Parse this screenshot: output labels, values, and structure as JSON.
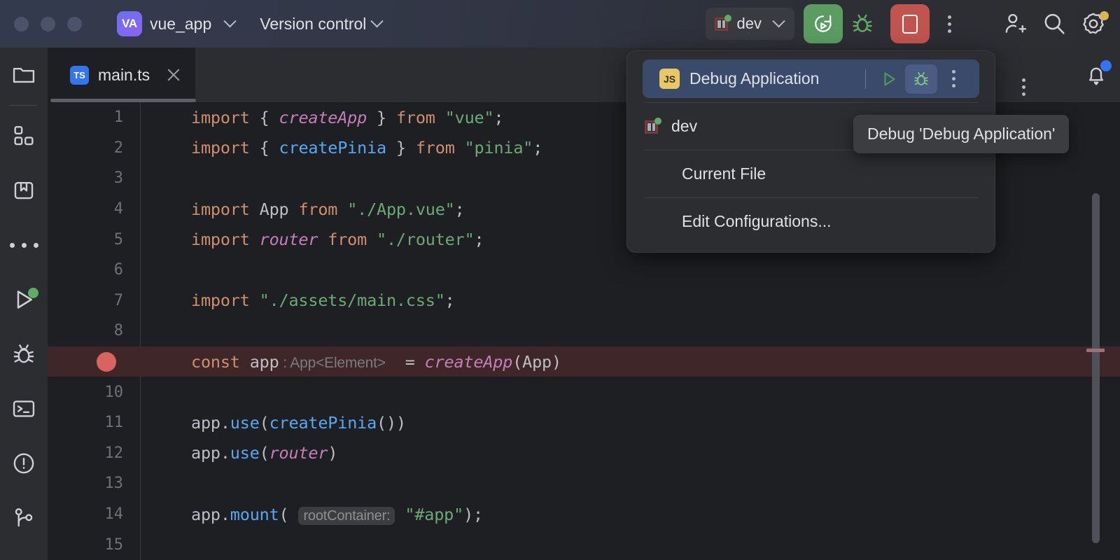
{
  "titlebar": {
    "project_badge": "VA",
    "project_name": "vue_app",
    "vcs_label": "Version control",
    "run_config_label": "dev",
    "traffic_lights": [
      "close",
      "minimize",
      "zoom"
    ]
  },
  "toolbar": {
    "rerun_icon": "rerun-icon",
    "debug_icon": "bug-icon",
    "stop_icon": "stop-icon",
    "more_icon": "more-vertical-icon",
    "add_user_icon": "add-user-icon",
    "search_icon": "search-icon",
    "settings_icon": "gear-icon",
    "settings_badge_color": "#e0b251",
    "green": "#5a9c62",
    "red": "#c25450"
  },
  "sidebar": {
    "items": [
      {
        "name": "project",
        "icon": "folder-icon"
      },
      {
        "name": "commit",
        "icon": "blocks-icon"
      },
      {
        "name": "bookmarks",
        "icon": "bookmark-icon"
      },
      {
        "name": "more-tools",
        "icon": "ellipsis-icon"
      },
      {
        "name": "run",
        "icon": "play-icon",
        "status_dot": "#5fad65"
      },
      {
        "name": "debug",
        "icon": "bug-icon"
      },
      {
        "name": "terminal",
        "icon": "terminal-icon"
      },
      {
        "name": "problems",
        "icon": "warning-circle-icon"
      },
      {
        "name": "version-control",
        "icon": "git-branch-icon"
      }
    ]
  },
  "editor": {
    "tab": {
      "label": "main.ts",
      "badge": "TS",
      "close": "close-icon"
    },
    "notification_icon": "bell-icon",
    "notification_badge_color": "#3574f0",
    "more_icon": "more-vertical-icon",
    "breakpoint_line": 9,
    "lines": [
      {
        "num": "1",
        "tokens": [
          {
            "t": "import ",
            "c": "kw"
          },
          {
            "t": "{ ",
            "c": "pl"
          },
          {
            "t": "createApp",
            "c": "fn"
          },
          {
            "t": " } ",
            "c": "pl"
          },
          {
            "t": "from ",
            "c": "kw"
          },
          {
            "t": "\"vue\"",
            "c": "str"
          },
          {
            "t": ";",
            "c": "pl"
          }
        ]
      },
      {
        "num": "2",
        "tokens": [
          {
            "t": "import ",
            "c": "kw"
          },
          {
            "t": "{ ",
            "c": "pl"
          },
          {
            "t": "createPinia",
            "c": "fn2"
          },
          {
            "t": " } ",
            "c": "pl"
          },
          {
            "t": "from ",
            "c": "kw"
          },
          {
            "t": "\"pinia\"",
            "c": "str"
          },
          {
            "t": ";",
            "c": "pl"
          }
        ]
      },
      {
        "num": "3",
        "tokens": []
      },
      {
        "num": "4",
        "tokens": [
          {
            "t": "import ",
            "c": "kw"
          },
          {
            "t": "App ",
            "c": "pl"
          },
          {
            "t": "from ",
            "c": "kw"
          },
          {
            "t": "\"./App.vue\"",
            "c": "str"
          },
          {
            "t": ";",
            "c": "pl"
          }
        ]
      },
      {
        "num": "5",
        "tokens": [
          {
            "t": "import ",
            "c": "kw"
          },
          {
            "t": "router ",
            "c": "fn"
          },
          {
            "t": "from ",
            "c": "kw"
          },
          {
            "t": "\"./router\"",
            "c": "str"
          },
          {
            "t": ";",
            "c": "pl"
          }
        ]
      },
      {
        "num": "6",
        "tokens": []
      },
      {
        "num": "7",
        "tokens": [
          {
            "t": "import ",
            "c": "kw"
          },
          {
            "t": "\"./assets/main.css\"",
            "c": "str"
          },
          {
            "t": ";",
            "c": "pl"
          }
        ]
      },
      {
        "num": "8",
        "tokens": []
      },
      {
        "num": "9",
        "highlight": true,
        "breakpoint": true,
        "tokens": [
          {
            "t": "const ",
            "c": "kw"
          },
          {
            "t": "app",
            "c": "pl"
          },
          {
            "t": " : App<Element>",
            "c": "hint"
          },
          {
            "t": "  = ",
            "c": "pl"
          },
          {
            "t": "createApp",
            "c": "fn"
          },
          {
            "t": "(App)",
            "c": "pl"
          }
        ]
      },
      {
        "num": "10",
        "tokens": []
      },
      {
        "num": "11",
        "tokens": [
          {
            "t": "app.",
            "c": "pl"
          },
          {
            "t": "use",
            "c": "fn2"
          },
          {
            "t": "(",
            "c": "pl"
          },
          {
            "t": "createPinia",
            "c": "fn2"
          },
          {
            "t": "())",
            "c": "pl"
          }
        ]
      },
      {
        "num": "12",
        "tokens": [
          {
            "t": "app.",
            "c": "pl"
          },
          {
            "t": "use",
            "c": "fn2"
          },
          {
            "t": "(",
            "c": "pl"
          },
          {
            "t": "router",
            "c": "fn"
          },
          {
            "t": ")",
            "c": "pl"
          }
        ]
      },
      {
        "num": "13",
        "tokens": []
      },
      {
        "num": "14",
        "tokens": [
          {
            "t": "app.",
            "c": "pl"
          },
          {
            "t": "mount",
            "c": "fn2"
          },
          {
            "t": "( ",
            "c": "pl"
          },
          {
            "t": "rootContainer:",
            "c": "phint"
          },
          {
            "t": " ",
            "c": "pl"
          },
          {
            "t": "\"#app\"",
            "c": "str"
          },
          {
            "t": ");",
            "c": "pl"
          }
        ]
      },
      {
        "num": "15",
        "tokens": []
      }
    ]
  },
  "run_config_popup": {
    "items": [
      {
        "label": "Debug Application",
        "badge": "JS",
        "selected": true,
        "actions": [
          "run-icon",
          "debug-icon",
          "more-vertical-icon"
        ]
      },
      {
        "label": "dev",
        "icon": "npm-icon",
        "status_dot": "#5fad65"
      },
      {
        "label": "Current File"
      },
      {
        "label": "Edit Configurations..."
      }
    ]
  },
  "tooltip": {
    "text": "Debug 'Debug Application'"
  }
}
